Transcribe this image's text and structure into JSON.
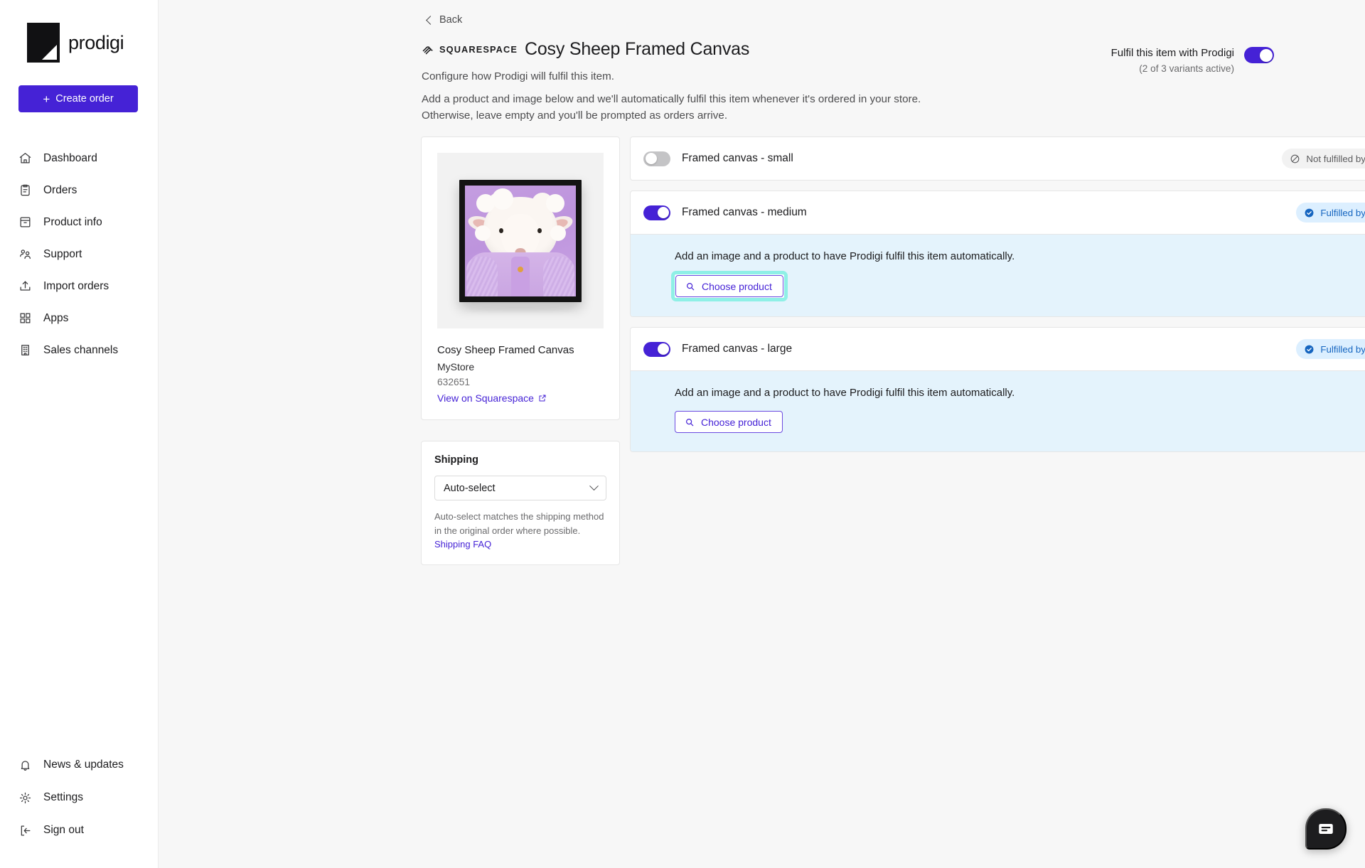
{
  "sidebar": {
    "brand": "prodigi",
    "create_order_label": "Create order",
    "create_order_plus": "+",
    "items": [
      {
        "label": "Dashboard",
        "icon": "home-icon"
      },
      {
        "label": "Orders",
        "icon": "clipboard-icon"
      },
      {
        "label": "Product info",
        "icon": "archive-box-icon"
      },
      {
        "label": "Support",
        "icon": "people-icon"
      },
      {
        "label": "Import orders",
        "icon": "upload-icon"
      },
      {
        "label": "Apps",
        "icon": "grid-icon"
      },
      {
        "label": "Sales channels",
        "icon": "building-icon"
      }
    ],
    "bottom_items": [
      {
        "label": "News & updates",
        "icon": "bell-icon"
      },
      {
        "label": "Settings",
        "icon": "gear-icon"
      },
      {
        "label": "Sign out",
        "icon": "sign-out-icon"
      }
    ]
  },
  "header": {
    "back_label": "Back",
    "channel_logo_word": "SQUARESPACE",
    "title": "Cosy Sheep Framed Canvas",
    "subtitle": "Configure how Prodigi will fulfil this item.",
    "description_line1": "Add a product and image below and we'll automatically fulfil this item whenever it's ordered in your store.",
    "description_line2": "Otherwise, leave empty and you'll be prompted as orders arrive.",
    "fulfil_toggle_label": "Fulfil this item with Prodigi",
    "fulfil_toggle_sub": "(2 of 3 variants active)",
    "fulfil_toggle_state": "on"
  },
  "product_card": {
    "name": "Cosy Sheep Framed Canvas",
    "store": "MyStore",
    "sku": "632651",
    "link_label": "View on Squarespace",
    "image_alt": "Framed canvas of a sheep in a lilac knitted cardigan on a purple background"
  },
  "shipping": {
    "title": "Shipping",
    "selected": "Auto-select",
    "options": [
      "Auto-select"
    ],
    "help_text": "Auto-select matches the shipping method in the original order where possible.",
    "help_link": "Shipping FAQ"
  },
  "variants": [
    {
      "name": "Framed canvas - small",
      "toggle_state": "off",
      "badge_label": "Not fulfilled by Prodigi",
      "badge_state": "off",
      "expanded": false,
      "body_text": "",
      "choose_label": "",
      "highlighted": false
    },
    {
      "name": "Framed canvas - medium",
      "toggle_state": "on",
      "badge_label": "Fulfilled by Prodigi",
      "badge_state": "on",
      "expanded": true,
      "body_text": "Add an image and a product to have Prodigi fulfil this item automatically.",
      "choose_label": "Choose product",
      "highlighted": true
    },
    {
      "name": "Framed canvas - large",
      "toggle_state": "on",
      "badge_label": "Fulfilled by Prodigi",
      "badge_state": "on",
      "expanded": true,
      "body_text": "Add an image and a product to have Prodigi fulfil this item automatically.",
      "choose_label": "Choose product",
      "highlighted": false
    }
  ],
  "chat": {
    "icon": "chat-bubble-icon"
  },
  "colors": {
    "brand_purple": "#4522d6",
    "badge_blue_bg": "#dcefff",
    "badge_blue_text": "#1565c0",
    "variant_body_bg": "#e4f3fc",
    "highlight_ring": "#8ff0e6",
    "page_bg": "#f7f7f7"
  }
}
